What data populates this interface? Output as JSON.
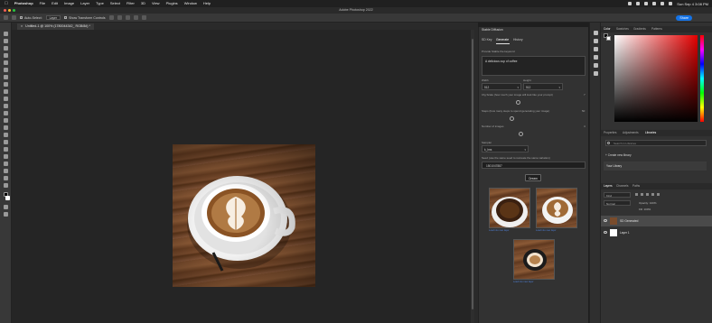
{
  "menubar": {
    "app": "Photoshop",
    "items": [
      "File",
      "Edit",
      "Image",
      "Layer",
      "Type",
      "Select",
      "Filter",
      "3D",
      "View",
      "Plugins",
      "Window",
      "Help"
    ],
    "clock": "Sun Sep 4 3:08 PM"
  },
  "window": {
    "title": "Adobe Photoshop 2022",
    "share_label": "Share"
  },
  "options_bar": {
    "auto_select_label": "Auto-Select:",
    "auto_select_value": "Layer",
    "transform_label": "Show Transform Controls"
  },
  "document": {
    "tab_label": "Untitled-1 @ 100% (1780044342_ RGB/8#) *"
  },
  "gen_panel": {
    "title": "Stable Diffusion",
    "tabs": [
      "SD Key",
      "Generate",
      "History"
    ],
    "active_tab": "Generate",
    "prompt_label": "Provide Stable the keyword",
    "prompt_value": "A delicious cup of coffee",
    "width_label": "Width",
    "width_value": "512",
    "height_label": "Height",
    "height_value": "512",
    "cfg_label": "Cfg Scale (how much your image will look like your prompt)",
    "cfg_value": "7",
    "steps_label": "Steps (how many steps to spend generating your image)",
    "steps_value": "50",
    "num_images_label": "Number of images",
    "num_images_value": "4",
    "sampler_label": "Sampler",
    "sampler_value": "k_lms",
    "seed_label": "Seed (use the same seed to recreate the same variation)",
    "seed_value": "1501047887",
    "dream_label": "Dream",
    "thumbs": [
      {
        "caption": "Load into new layer"
      },
      {
        "caption": "Load into new layer"
      },
      {
        "caption": "Load into new layer"
      }
    ]
  },
  "right_panel": {
    "color_tabs": [
      "Color",
      "Swatches",
      "Gradients",
      "Patterns"
    ],
    "lib_tabs": [
      "Properties",
      "Adjustments",
      "Libraries"
    ],
    "lib_search_placeholder": "Search in Libraries",
    "create_library": "+ Create new library",
    "your_library": "Your Library",
    "layer_tabs": [
      "Layers",
      "Channels",
      "Paths"
    ],
    "layer_filter": "Kind",
    "blend_mode": "Normal",
    "opacity_label": "Opacity: 100%",
    "fill_label": "Fill: 100%",
    "layers": [
      {
        "name": "SD Generated"
      },
      {
        "name": "Layer 1"
      }
    ]
  },
  "colors": {
    "accent": "#1473e6",
    "panel": "#323232",
    "canvas": "#252525"
  }
}
